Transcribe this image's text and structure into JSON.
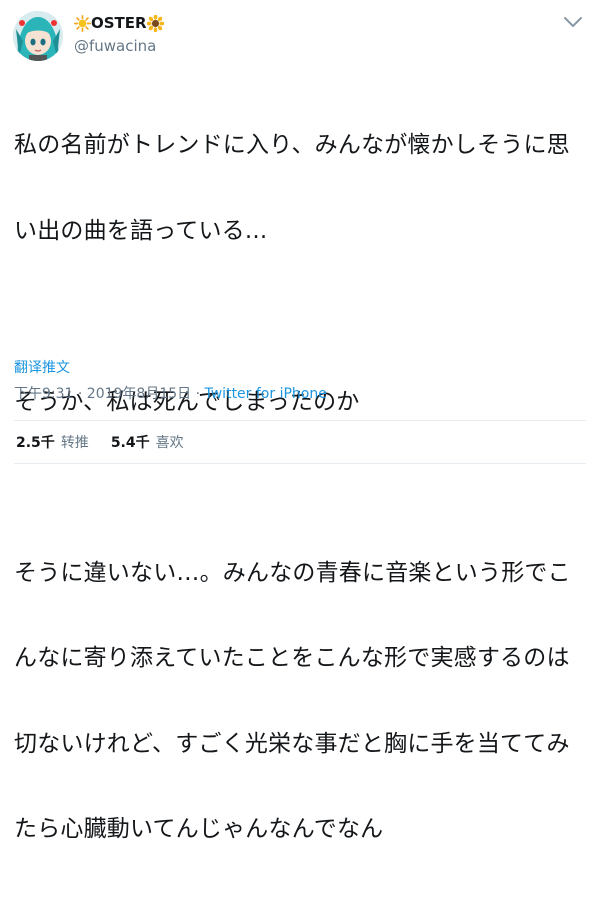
{
  "user": {
    "display_name": "OSTER",
    "handle": "@fuwacina",
    "avatar_icon": "anime-avatar-icon"
  },
  "menu_icon": "chevron-down-icon",
  "tweet": {
    "lines": [
      "私の名前がトレンドに入り、みんなが懐かしそうに思",
      "い出の曲を語っている...",
      "",
      "そうか、私は死んでしまったのか",
      "",
      "そうに違いない…。みんなの青春に音楽という形でこ",
      "んなに寄り添えていたことをこんな形で実感するのは",
      "切ないけれど、すごく光栄な事だと胸に手を当ててみ",
      "たら心臓動いてんじゃんなんでなん"
    ],
    "translate_label": "翻译推文",
    "timestamp": "下午9:31 · 2019年8月15日 · ",
    "source": "Twitter for iPhone"
  },
  "stats": {
    "retweets_value": "2.5千",
    "retweets_label": "转推",
    "likes_value": "5.4千",
    "likes_label": "喜欢"
  },
  "colors": {
    "text": "#14171a",
    "secondary": "#657786",
    "link": "#1b95e0",
    "divider": "#e6ecf0"
  }
}
